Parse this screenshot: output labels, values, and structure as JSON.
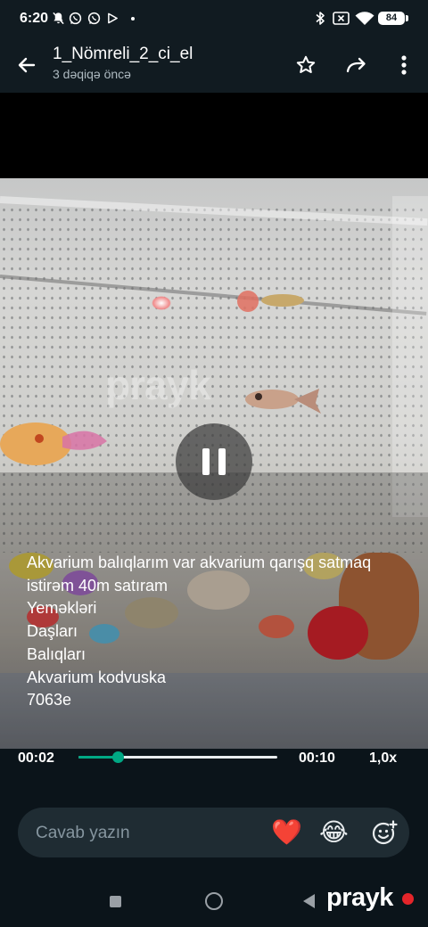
{
  "status_bar": {
    "time": "6:20",
    "battery": "84"
  },
  "header": {
    "title": "1_Nömreli_2_ci_el",
    "subtitle": "3 dəqiqə öncə",
    "icons": [
      "back-arrow-icon",
      "star-icon",
      "forward-icon",
      "more-vertical-icon"
    ]
  },
  "video": {
    "watermark": "prayk",
    "caption_lines": [
      "Akvarium balıqlarım var akvarium qarışq satmaq",
      "istirəm 40m satıram",
      "Yeməkləri",
      "Daşları",
      "Balıqları",
      "Akvarium kodvuska",
      "7063e"
    ],
    "state": "playing"
  },
  "progress": {
    "current": "00:02",
    "duration": "00:10",
    "speed": "1,0x",
    "fraction": 0.2,
    "color": "#00a884"
  },
  "reply": {
    "placeholder": "Cavab yazın",
    "reactions": [
      "❤️",
      "😂"
    ]
  },
  "watermark_brand": {
    "text": "prayk",
    "dot_color": "#e5252a"
  }
}
